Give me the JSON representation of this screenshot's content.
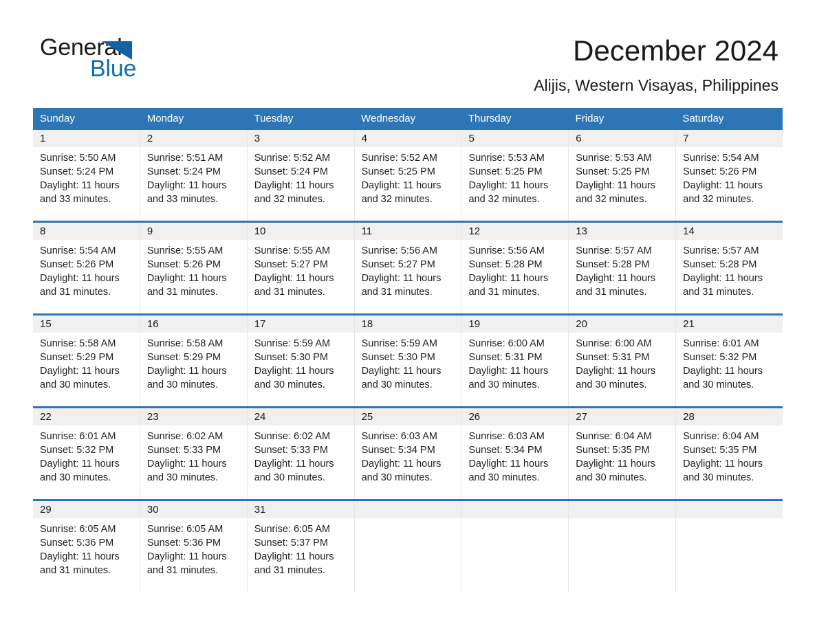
{
  "brand": {
    "name_part1": "General",
    "name_part2": "Blue",
    "triangle_color": "#1461a6",
    "blue_color": "#0f6ab4"
  },
  "header": {
    "title": "December 2024",
    "subtitle": "Alijis, Western Visayas, Philippines"
  },
  "theme": {
    "header_blue": "#2e75b6",
    "day_strip_gray": "#f0f0f0",
    "text_color": "#1a1a1a"
  },
  "calendar": {
    "weekday_headers": [
      "Sunday",
      "Monday",
      "Tuesday",
      "Wednesday",
      "Thursday",
      "Friday",
      "Saturday"
    ],
    "weeks": [
      [
        {
          "day": "1",
          "sunrise": "Sunrise: 5:50 AM",
          "sunset": "Sunset: 5:24 PM",
          "daylight": "Daylight: 11 hours and 33 minutes."
        },
        {
          "day": "2",
          "sunrise": "Sunrise: 5:51 AM",
          "sunset": "Sunset: 5:24 PM",
          "daylight": "Daylight: 11 hours and 33 minutes."
        },
        {
          "day": "3",
          "sunrise": "Sunrise: 5:52 AM",
          "sunset": "Sunset: 5:24 PM",
          "daylight": "Daylight: 11 hours and 32 minutes."
        },
        {
          "day": "4",
          "sunrise": "Sunrise: 5:52 AM",
          "sunset": "Sunset: 5:25 PM",
          "daylight": "Daylight: 11 hours and 32 minutes."
        },
        {
          "day": "5",
          "sunrise": "Sunrise: 5:53 AM",
          "sunset": "Sunset: 5:25 PM",
          "daylight": "Daylight: 11 hours and 32 minutes."
        },
        {
          "day": "6",
          "sunrise": "Sunrise: 5:53 AM",
          "sunset": "Sunset: 5:25 PM",
          "daylight": "Daylight: 11 hours and 32 minutes."
        },
        {
          "day": "7",
          "sunrise": "Sunrise: 5:54 AM",
          "sunset": "Sunset: 5:26 PM",
          "daylight": "Daylight: 11 hours and 32 minutes."
        }
      ],
      [
        {
          "day": "8",
          "sunrise": "Sunrise: 5:54 AM",
          "sunset": "Sunset: 5:26 PM",
          "daylight": "Daylight: 11 hours and 31 minutes."
        },
        {
          "day": "9",
          "sunrise": "Sunrise: 5:55 AM",
          "sunset": "Sunset: 5:26 PM",
          "daylight": "Daylight: 11 hours and 31 minutes."
        },
        {
          "day": "10",
          "sunrise": "Sunrise: 5:55 AM",
          "sunset": "Sunset: 5:27 PM",
          "daylight": "Daylight: 11 hours and 31 minutes."
        },
        {
          "day": "11",
          "sunrise": "Sunrise: 5:56 AM",
          "sunset": "Sunset: 5:27 PM",
          "daylight": "Daylight: 11 hours and 31 minutes."
        },
        {
          "day": "12",
          "sunrise": "Sunrise: 5:56 AM",
          "sunset": "Sunset: 5:28 PM",
          "daylight": "Daylight: 11 hours and 31 minutes."
        },
        {
          "day": "13",
          "sunrise": "Sunrise: 5:57 AM",
          "sunset": "Sunset: 5:28 PM",
          "daylight": "Daylight: 11 hours and 31 minutes."
        },
        {
          "day": "14",
          "sunrise": "Sunrise: 5:57 AM",
          "sunset": "Sunset: 5:28 PM",
          "daylight": "Daylight: 11 hours and 31 minutes."
        }
      ],
      [
        {
          "day": "15",
          "sunrise": "Sunrise: 5:58 AM",
          "sunset": "Sunset: 5:29 PM",
          "daylight": "Daylight: 11 hours and 30 minutes."
        },
        {
          "day": "16",
          "sunrise": "Sunrise: 5:58 AM",
          "sunset": "Sunset: 5:29 PM",
          "daylight": "Daylight: 11 hours and 30 minutes."
        },
        {
          "day": "17",
          "sunrise": "Sunrise: 5:59 AM",
          "sunset": "Sunset: 5:30 PM",
          "daylight": "Daylight: 11 hours and 30 minutes."
        },
        {
          "day": "18",
          "sunrise": "Sunrise: 5:59 AM",
          "sunset": "Sunset: 5:30 PM",
          "daylight": "Daylight: 11 hours and 30 minutes."
        },
        {
          "day": "19",
          "sunrise": "Sunrise: 6:00 AM",
          "sunset": "Sunset: 5:31 PM",
          "daylight": "Daylight: 11 hours and 30 minutes."
        },
        {
          "day": "20",
          "sunrise": "Sunrise: 6:00 AM",
          "sunset": "Sunset: 5:31 PM",
          "daylight": "Daylight: 11 hours and 30 minutes."
        },
        {
          "day": "21",
          "sunrise": "Sunrise: 6:01 AM",
          "sunset": "Sunset: 5:32 PM",
          "daylight": "Daylight: 11 hours and 30 minutes."
        }
      ],
      [
        {
          "day": "22",
          "sunrise": "Sunrise: 6:01 AM",
          "sunset": "Sunset: 5:32 PM",
          "daylight": "Daylight: 11 hours and 30 minutes."
        },
        {
          "day": "23",
          "sunrise": "Sunrise: 6:02 AM",
          "sunset": "Sunset: 5:33 PM",
          "daylight": "Daylight: 11 hours and 30 minutes."
        },
        {
          "day": "24",
          "sunrise": "Sunrise: 6:02 AM",
          "sunset": "Sunset: 5:33 PM",
          "daylight": "Daylight: 11 hours and 30 minutes."
        },
        {
          "day": "25",
          "sunrise": "Sunrise: 6:03 AM",
          "sunset": "Sunset: 5:34 PM",
          "daylight": "Daylight: 11 hours and 30 minutes."
        },
        {
          "day": "26",
          "sunrise": "Sunrise: 6:03 AM",
          "sunset": "Sunset: 5:34 PM",
          "daylight": "Daylight: 11 hours and 30 minutes."
        },
        {
          "day": "27",
          "sunrise": "Sunrise: 6:04 AM",
          "sunset": "Sunset: 5:35 PM",
          "daylight": "Daylight: 11 hours and 30 minutes."
        },
        {
          "day": "28",
          "sunrise": "Sunrise: 6:04 AM",
          "sunset": "Sunset: 5:35 PM",
          "daylight": "Daylight: 11 hours and 30 minutes."
        }
      ],
      [
        {
          "day": "29",
          "sunrise": "Sunrise: 6:05 AM",
          "sunset": "Sunset: 5:36 PM",
          "daylight": "Daylight: 11 hours and 31 minutes."
        },
        {
          "day": "30",
          "sunrise": "Sunrise: 6:05 AM",
          "sunset": "Sunset: 5:36 PM",
          "daylight": "Daylight: 11 hours and 31 minutes."
        },
        {
          "day": "31",
          "sunrise": "Sunrise: 6:05 AM",
          "sunset": "Sunset: 5:37 PM",
          "daylight": "Daylight: 11 hours and 31 minutes."
        },
        {
          "day": "",
          "sunrise": "",
          "sunset": "",
          "daylight": ""
        },
        {
          "day": "",
          "sunrise": "",
          "sunset": "",
          "daylight": ""
        },
        {
          "day": "",
          "sunrise": "",
          "sunset": "",
          "daylight": ""
        },
        {
          "day": "",
          "sunrise": "",
          "sunset": "",
          "daylight": ""
        }
      ]
    ]
  }
}
